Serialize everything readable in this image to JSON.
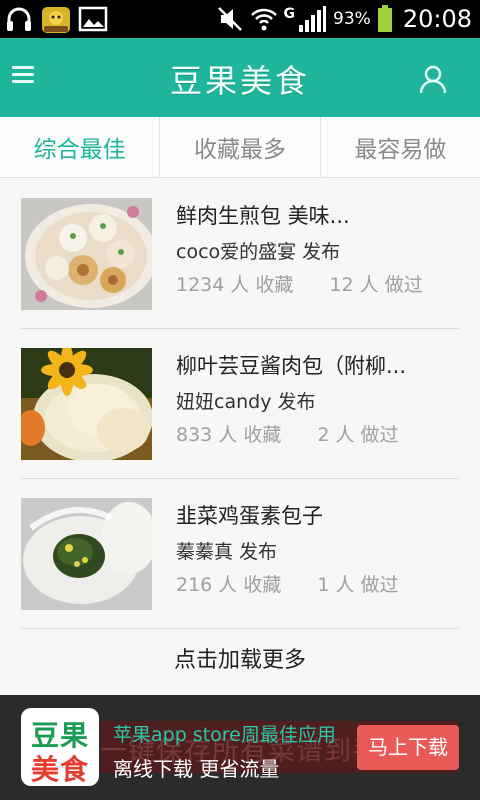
{
  "status_bar": {
    "network_type": "G",
    "battery_percent": "93%",
    "time": "20:08",
    "icons": [
      "headset-icon",
      "game-app-icon",
      "gallery-icon",
      "mute-icon",
      "wifi-icon",
      "signal-icon",
      "battery-icon"
    ]
  },
  "header": {
    "title": "豆果美食",
    "accent_color": "#1eb59b"
  },
  "tabs": [
    {
      "label": "综合最佳",
      "active": true
    },
    {
      "label": "收藏最多",
      "active": false
    },
    {
      "label": "最容易做",
      "active": false
    }
  ],
  "recipes": [
    {
      "title": "鲜肉生煎包 美味...",
      "author": "coco爱的盛宴 发布",
      "favorites": "1234 人 收藏",
      "made": "12 人 做过"
    },
    {
      "title": "柳叶芸豆酱肉包（附柳...",
      "author": "妞妞candy 发布",
      "favorites": "833 人 收藏",
      "made": "2 人 做过"
    },
    {
      "title": "韭菜鸡蛋素包子",
      "author": "蓁蓁真 发布",
      "favorites": "216 人 收藏",
      "made": "1 人 做过"
    }
  ],
  "load_more": "点击加载更多",
  "ad": {
    "logo_line1": "豆果",
    "logo_line2": "美食",
    "line1": "苹果app store周最佳应用",
    "line2": "离线下载 更省流量",
    "background_text": "一键保存所有菜谱到手",
    "button": "马上下载",
    "button_color": "#e85a58"
  }
}
